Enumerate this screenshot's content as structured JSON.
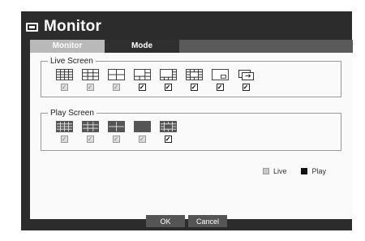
{
  "window": {
    "title": "Monitor",
    "icon": "monitor-icon"
  },
  "tabs": [
    {
      "label": "Monitor",
      "active": true
    },
    {
      "label": "Mode",
      "active": false
    }
  ],
  "live_screen": {
    "label": "Live Screen",
    "layouts": [
      {
        "name": "16-split",
        "checked": false
      },
      {
        "name": "9-split",
        "checked": false
      },
      {
        "name": "4-split",
        "checked": false
      },
      {
        "name": "6-split",
        "checked": true
      },
      {
        "name": "8-split",
        "checked": true
      },
      {
        "name": "13-split",
        "checked": true
      },
      {
        "name": "pip",
        "checked": true
      },
      {
        "name": "sequence",
        "checked": true
      }
    ]
  },
  "play_screen": {
    "label": "Play Screen",
    "layouts": [
      {
        "name": "16-split",
        "checked": false
      },
      {
        "name": "9-split",
        "checked": false
      },
      {
        "name": "4-split",
        "checked": false
      },
      {
        "name": "single",
        "checked": false
      },
      {
        "name": "13-split",
        "checked": true
      }
    ]
  },
  "legend": {
    "live": "Live",
    "play": "Play"
  },
  "buttons": {
    "ok": "OK",
    "cancel": "Cancel"
  },
  "colors": {
    "background": "#2c2c2c",
    "panel": "#fafafa",
    "tab_active": "#b9b9b9",
    "button": "#555555",
    "play_fill": "#555555"
  }
}
